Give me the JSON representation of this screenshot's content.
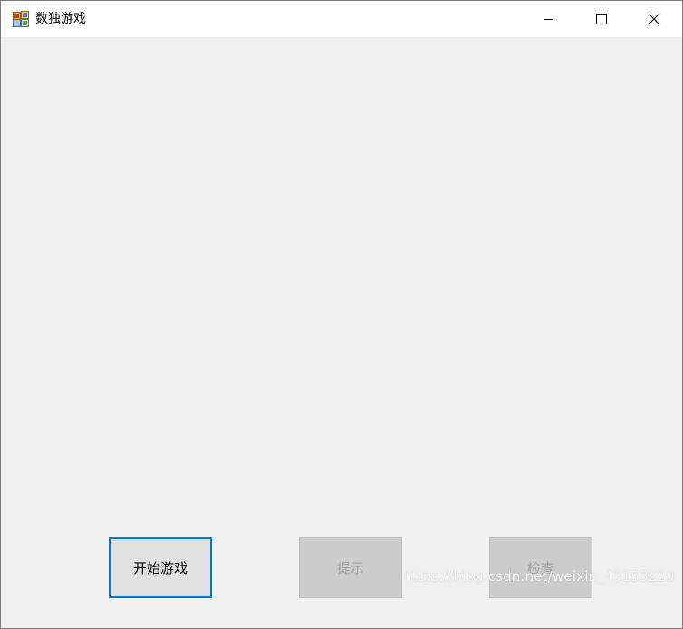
{
  "window": {
    "title": "数独游戏",
    "app_icon": "winforms-app-icon",
    "controls": {
      "minimize_icon": "minimize-icon",
      "maximize_icon": "maximize-icon",
      "close_icon": "close-icon"
    }
  },
  "buttons": {
    "start_label": "开始游戏",
    "hint_label": "提示",
    "check_label": "检查"
  },
  "watermark": "https://blog.csdn.net/weixin_43153229",
  "colors": {
    "focus_border": "#0078d7",
    "client_bg": "#f0f0f0",
    "disabled_button_bg": "#cccccc",
    "disabled_text": "#a0a0a0"
  }
}
